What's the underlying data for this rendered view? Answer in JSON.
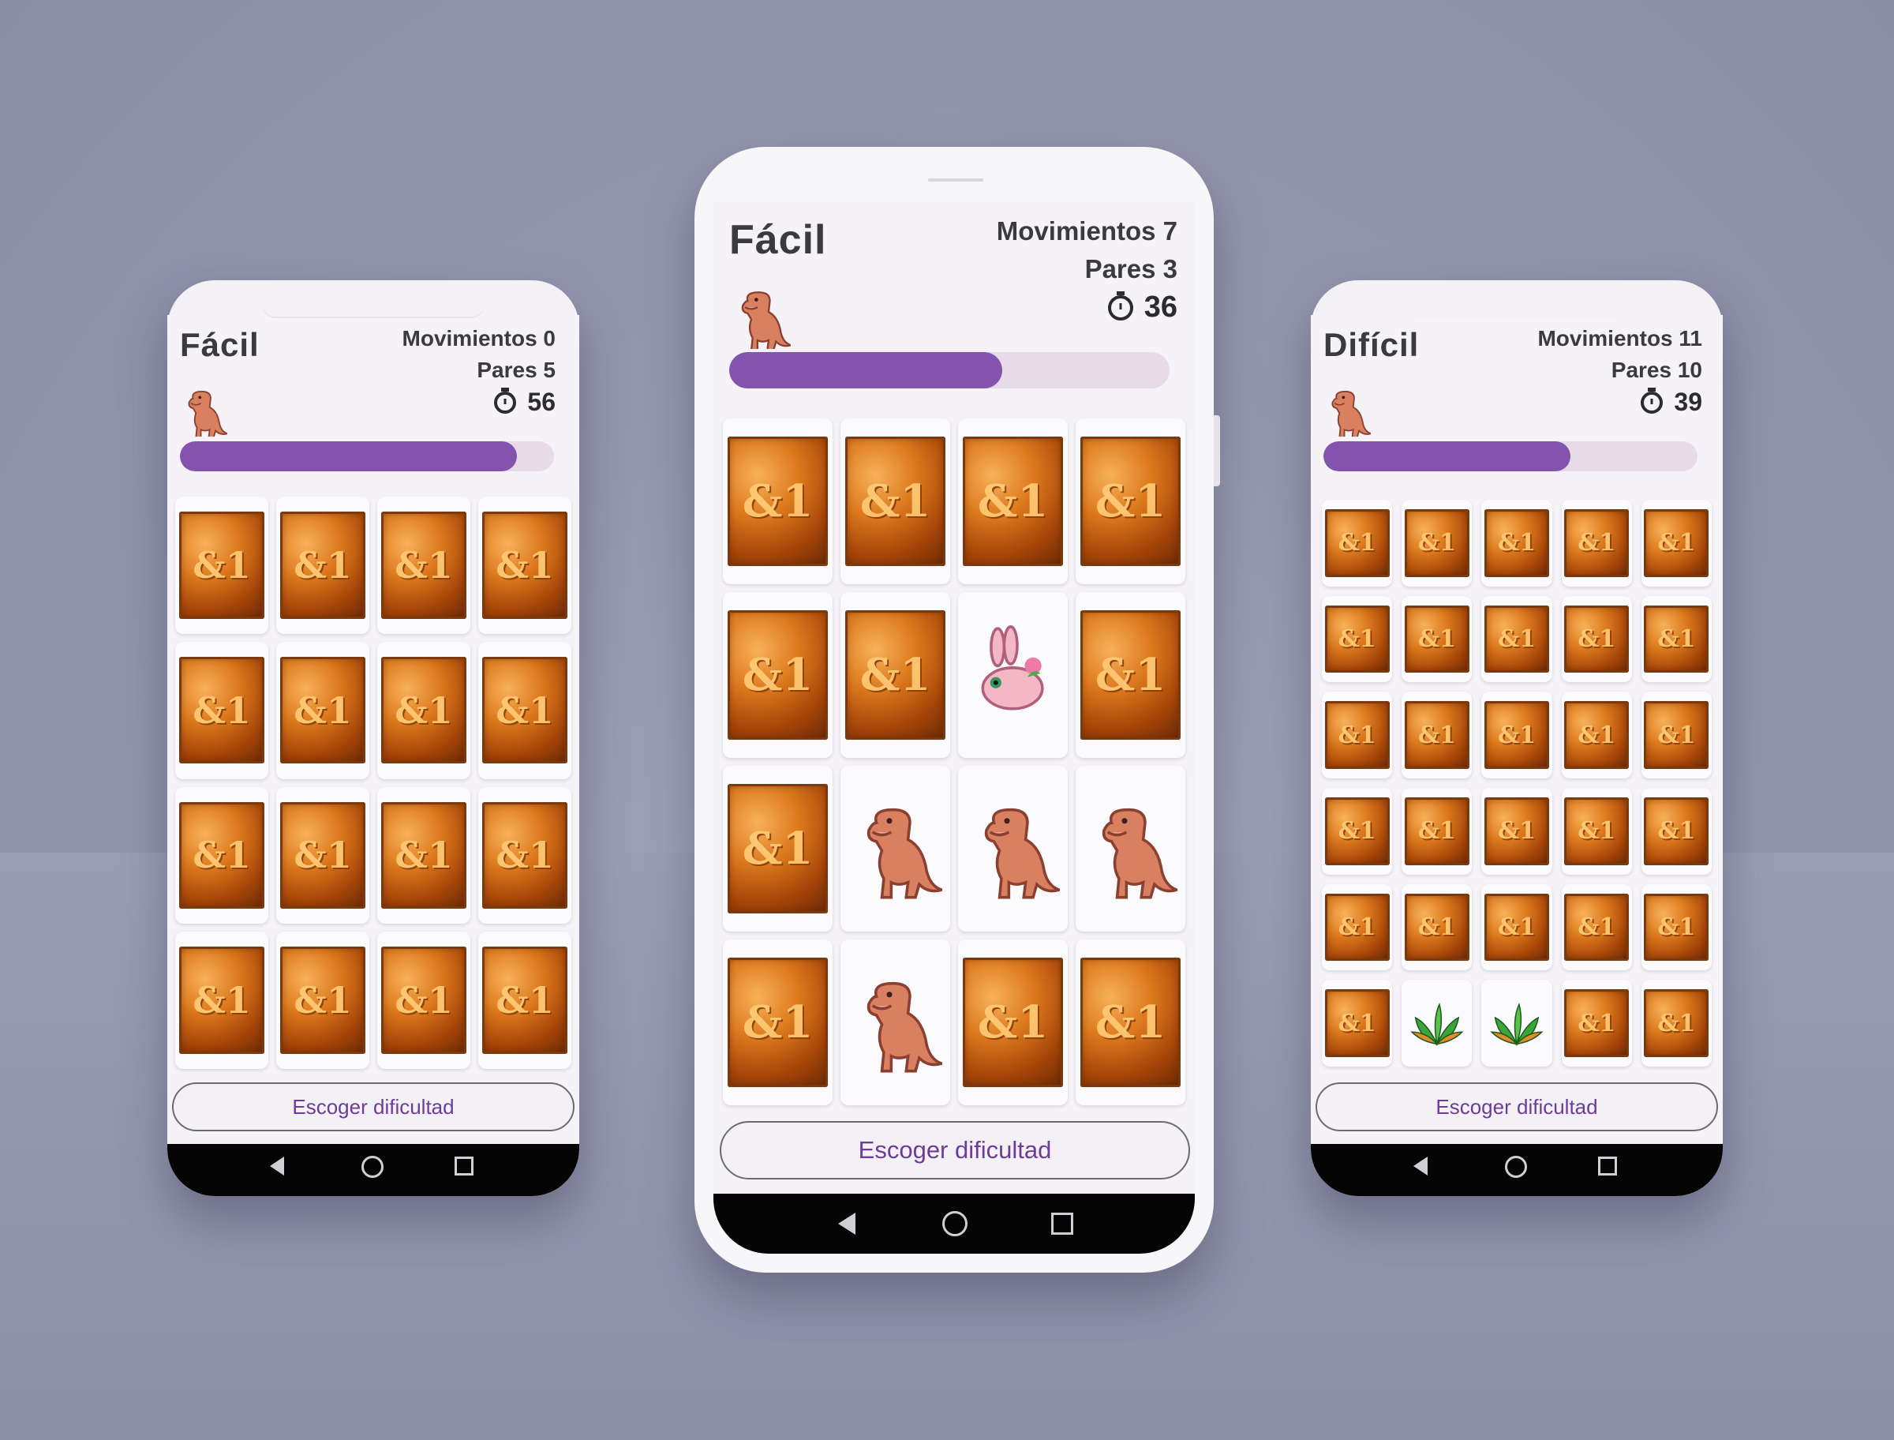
{
  "screens": {
    "left": {
      "title": "Fácil",
      "moves_label": "Movimientos 0",
      "pairs_label": "Pares 5",
      "timer": "56",
      "progress": 0.9,
      "button": "Escoger dificultad",
      "cards": [
        "back",
        "back",
        "back",
        "back",
        "back",
        "back",
        "back",
        "back",
        "back",
        "back",
        "back",
        "back",
        "back",
        "back",
        "back",
        "back"
      ]
    },
    "center": {
      "title": "Fácil",
      "moves_label": "Movimientos 7",
      "pairs_label": "Pares 3",
      "timer": "36",
      "progress": 0.62,
      "button": "Escoger dificultad",
      "cards": [
        "back",
        "back",
        "back",
        "back",
        "back",
        "back",
        "bunny",
        "back",
        "back",
        "dino",
        "dino",
        "dino",
        "back",
        "dino",
        "back",
        "back"
      ]
    },
    "right": {
      "title": "Difícil",
      "moves_label": "Movimientos 11",
      "pairs_label": "Pares 10",
      "timer": "39",
      "progress": 0.66,
      "button": "Escoger dificultad",
      "cards": [
        "back",
        "back",
        "back",
        "back",
        "back",
        "back",
        "back",
        "back",
        "back",
        "back",
        "back",
        "back",
        "back",
        "back",
        "back",
        "back",
        "back",
        "back",
        "back",
        "back",
        "back",
        "back",
        "back",
        "back",
        "back",
        "back",
        "plant",
        "plant",
        "back",
        "back"
      ]
    }
  },
  "icons": {
    "mascot": "dino-mascot-icon",
    "timer": "stopwatch-icon",
    "card_back": "card-back-icon",
    "nav_back": "back-triangle-icon",
    "nav_home": "home-circle-icon",
    "nav_recents": "recents-square-icon"
  },
  "glyphs": {
    "card_back": "&1"
  },
  "colors": {
    "accent": "#8453ad",
    "track": "#e8dbe8",
    "button_text": "#6d3c9a",
    "background": "#9497ae"
  }
}
